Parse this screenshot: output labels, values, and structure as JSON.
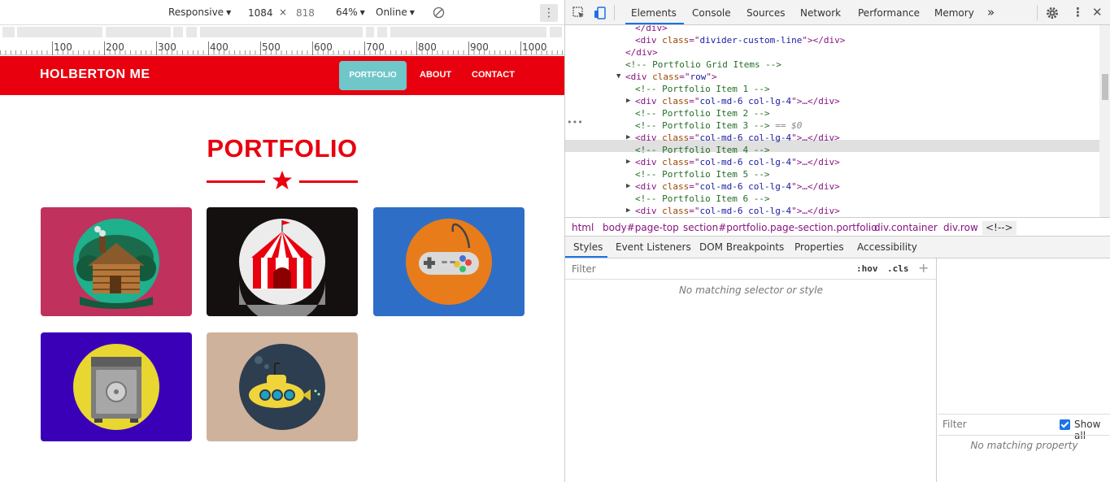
{
  "device_toolbar": {
    "device": "Responsive",
    "width": "1084",
    "times": "×",
    "height": "818",
    "zoom": "64%",
    "throttle": "Online"
  },
  "ruler_labels": [
    "100",
    "200",
    "300",
    "400",
    "500",
    "600",
    "700",
    "800",
    "900",
    "1000"
  ],
  "site": {
    "brand": "HOLBERTON ME",
    "nav": {
      "portfolio": "PORTFOLIO",
      "about": "ABOUT",
      "contact": "CONTACT"
    },
    "heading": "PORTFOLIO",
    "colors": {
      "primary": "#e8000e",
      "accent": "#6fc7c9"
    },
    "items": [
      {
        "icon": "cabin-icon",
        "bg": "#c0315d",
        "circle": "#1fb08c"
      },
      {
        "icon": "circus-tent-icon",
        "bg": "#141010",
        "circle": "#ececec"
      },
      {
        "icon": "game-controller-icon",
        "bg": "#2f6ec7",
        "circle": "#e87c1b"
      },
      {
        "icon": "safe-icon",
        "bg": "#3a00b8",
        "circle": "#e8d631"
      },
      {
        "icon": "submarine-icon",
        "bg": "#cfb29c",
        "circle": "#2d3e50"
      }
    ]
  },
  "devtools": {
    "tabs": [
      "Elements",
      "Console",
      "Sources",
      "Network",
      "Performance",
      "Memory"
    ],
    "more": "»",
    "dom": [
      {
        "type": "tag",
        "indent": 2,
        "text": "</div>",
        "partial": true
      },
      {
        "type": "el",
        "indent": 2,
        "tag": "div",
        "attr": "class",
        "val": "divider-custom-line",
        "close": "></div>"
      },
      {
        "type": "tag",
        "indent": 1,
        "text": "</div>"
      },
      {
        "type": "comment",
        "indent": 1,
        "text": "<!-- Portfolio Grid Items -->"
      },
      {
        "type": "el",
        "indent": 1,
        "tag": "div",
        "attr": "class",
        "val": "row",
        "close": ">",
        "arrow": "▼"
      },
      {
        "type": "comment",
        "indent": 2,
        "text": "<!-- Portfolio Item 1 -->"
      },
      {
        "type": "el",
        "indent": 2,
        "tag": "div",
        "attr": "class",
        "val": "col-md-6 col-lg-4",
        "close": ">…</div>",
        "arrow": "▶"
      },
      {
        "type": "comment",
        "indent": 2,
        "text": "<!-- Portfolio Item 2 -->"
      },
      {
        "type": "comment",
        "indent": 2,
        "text": "<!-- Portfolio Item 3 -->",
        "selected": true,
        "suffix": " == $0"
      },
      {
        "type": "el",
        "indent": 2,
        "tag": "div",
        "attr": "class",
        "val": "col-md-6 col-lg-4",
        "close": ">…</div>",
        "arrow": "▶"
      },
      {
        "type": "comment",
        "indent": 2,
        "text": "<!-- Portfolio Item 4 -->"
      },
      {
        "type": "el",
        "indent": 2,
        "tag": "div",
        "attr": "class",
        "val": "col-md-6 col-lg-4",
        "close": ">…</div>",
        "arrow": "▶"
      },
      {
        "type": "comment",
        "indent": 2,
        "text": "<!-- Portfolio Item 5 -->"
      },
      {
        "type": "el",
        "indent": 2,
        "tag": "div",
        "attr": "class",
        "val": "col-md-6 col-lg-4",
        "close": ">…</div>",
        "arrow": "▶"
      },
      {
        "type": "comment",
        "indent": 2,
        "text": "<!-- Portfolio Item 6 -->"
      },
      {
        "type": "el",
        "indent": 2,
        "tag": "div",
        "attr": "class",
        "val": "col-md-6 col-lg-4",
        "close": ">…</div>",
        "arrow": "▶"
      },
      {
        "type": "tag",
        "indent": 1,
        "text": "</div>",
        "partial": true
      }
    ],
    "breadcrumbs": [
      "html",
      "body#page-top",
      "section#portfolio.page-section.portfolio",
      "div.container",
      "div.row",
      "<!-->"
    ],
    "sub_tabs": [
      "Styles",
      "Event Listeners",
      "DOM Breakpoints",
      "Properties",
      "Accessibility"
    ],
    "styles": {
      "filter_placeholder": "Filter",
      "hov": ":hov",
      "cls": ".cls",
      "plus": "+",
      "empty": "No matching selector or style"
    },
    "computed": {
      "filter_placeholder": "Filter",
      "show_all": "Show all",
      "empty": "No matching property"
    }
  }
}
